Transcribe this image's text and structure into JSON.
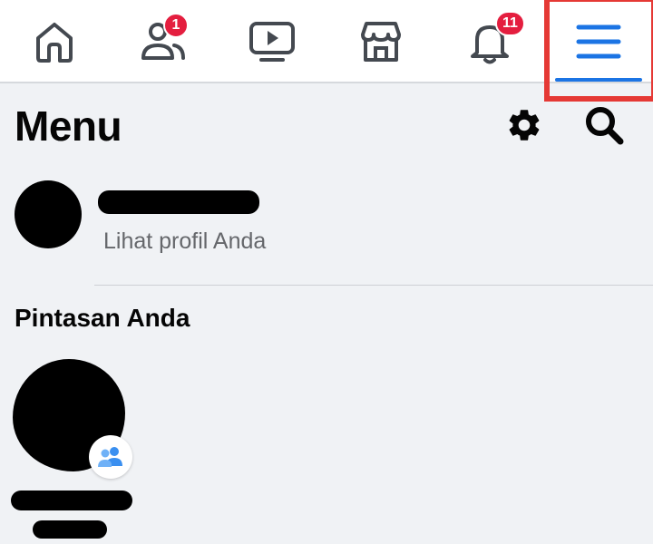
{
  "nav": {
    "friends_badge": "1",
    "notifications_badge": "11",
    "colors": {
      "icon": "#444950",
      "active": "#1b74e4",
      "badge": "#e41e3f",
      "highlight": "#e53935"
    }
  },
  "header": {
    "title": "Menu",
    "icons": [
      "gear-icon",
      "search-icon"
    ]
  },
  "profile": {
    "subtitle": "Lihat profil Anda"
  },
  "shortcuts": {
    "title": "Pintasan Anda",
    "items": [
      {
        "icon": "group-icon"
      }
    ]
  }
}
